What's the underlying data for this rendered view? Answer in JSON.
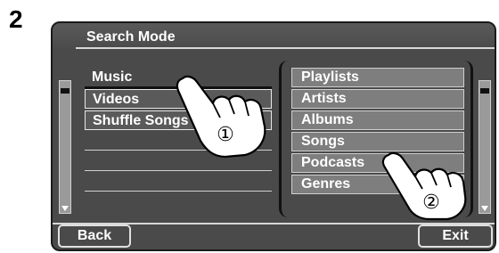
{
  "step": "2",
  "screen": {
    "title": "Search Mode",
    "left_list": [
      "Music",
      "Videos",
      "Shuffle Songs"
    ],
    "right_list": [
      "Playlists",
      "Artists",
      "Albums",
      "Songs",
      "Podcasts",
      "Genres"
    ],
    "buttons": {
      "back": "Back",
      "exit": "Exit"
    }
  },
  "callouts": {
    "first": "①",
    "second": "②"
  }
}
